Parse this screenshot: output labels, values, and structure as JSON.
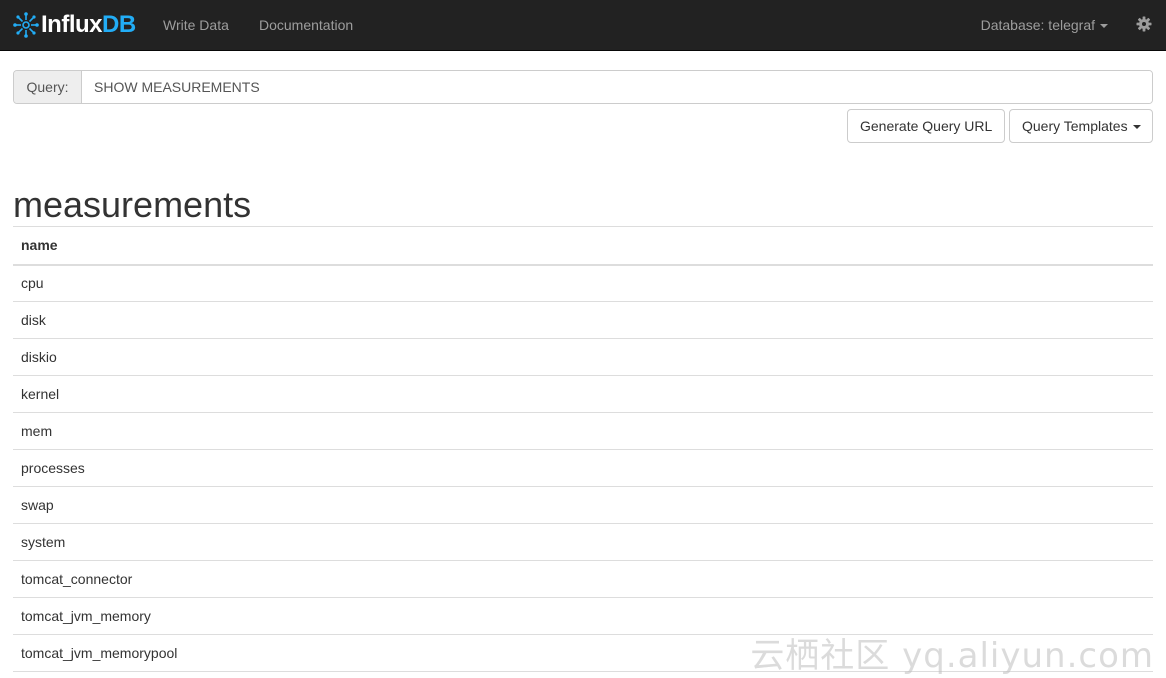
{
  "navbar": {
    "brand": {
      "influx": "Influx",
      "db": "DB",
      "icon": "influxdb-logo-icon"
    },
    "links": {
      "write_data": "Write Data",
      "documentation": "Documentation"
    },
    "database_label": "Database: telegraf",
    "settings_icon": "gear-icon"
  },
  "query": {
    "label": "Query:",
    "value": "SHOW MEASUREMENTS"
  },
  "actions": {
    "generate_url": "Generate Query URL",
    "templates": "Query Templates"
  },
  "results": {
    "title": "measurements",
    "column": "name",
    "rows": [
      "cpu",
      "disk",
      "diskio",
      "kernel",
      "mem",
      "processes",
      "swap",
      "system",
      "tomcat_connector",
      "tomcat_jvm_memory",
      "tomcat_jvm_memorypool"
    ]
  },
  "watermark": "云栖社区 yq.aliyun.com",
  "colors": {
    "navbar_bg": "#222222",
    "brand_accent": "#22adf6",
    "nav_text": "#9d9d9d",
    "border": "#dddddd"
  }
}
